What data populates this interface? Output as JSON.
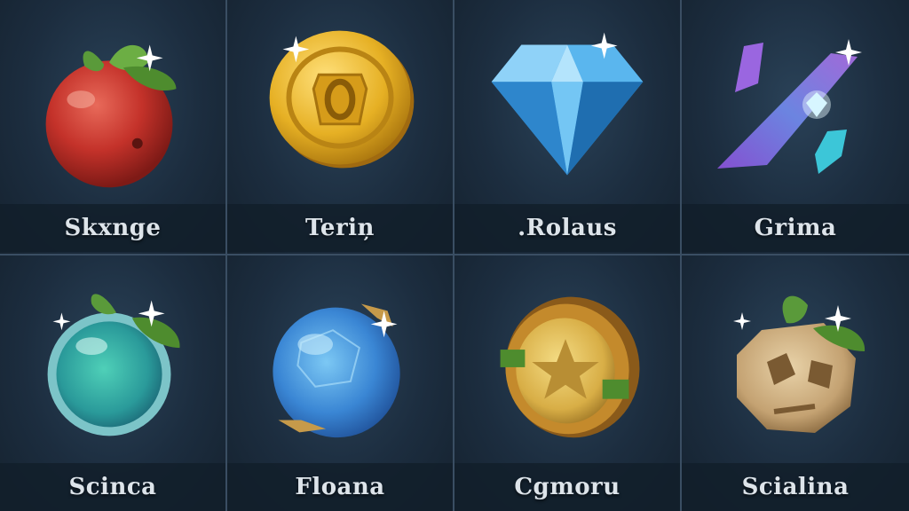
{
  "items": [
    {
      "label": "Skxnge",
      "icon": "red-fruit-icon"
    },
    {
      "label": "Teriņ",
      "icon": "gold-coin-icon"
    },
    {
      "label": ".Rolaus",
      "icon": "blue-diamond-icon"
    },
    {
      "label": "Grima",
      "icon": "purple-crystal-icon"
    },
    {
      "label": "Scinca",
      "icon": "teal-orb-icon"
    },
    {
      "label": "Floana",
      "icon": "blue-gem-icon"
    },
    {
      "label": "Cgmoru",
      "icon": "star-medallion-icon"
    },
    {
      "label": "Scialina",
      "icon": "stone-fruit-icon"
    }
  ],
  "colors": {
    "background": "#1a2a3a",
    "divider": "#3a4e63",
    "label_text": "#dde4ea"
  }
}
